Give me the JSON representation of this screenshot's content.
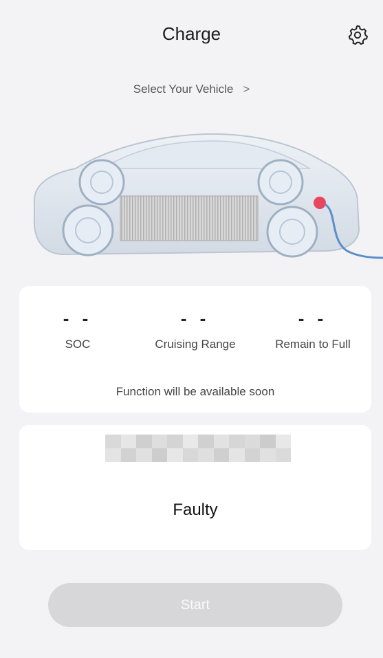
{
  "header": {
    "title": "Charge",
    "settings_icon": "gear-icon"
  },
  "vehicle_selector": {
    "label": "Select Your Vehicle",
    "chevron": ">"
  },
  "metrics": [
    {
      "value": "- -",
      "label": "SOC"
    },
    {
      "value": "- -",
      "label": "Cruising Range"
    },
    {
      "value": "- -",
      "label": "Remain to Full"
    }
  ],
  "notice": "Function will be available soon",
  "status": {
    "text": "Faulty"
  },
  "start_button": {
    "label": "Start"
  },
  "colors": {
    "background": "#f3f3f5",
    "card": "#ffffff",
    "button_disabled": "#d7d7d9",
    "charge_port": "#e8465f",
    "charge_cable": "#5a8fc8"
  }
}
